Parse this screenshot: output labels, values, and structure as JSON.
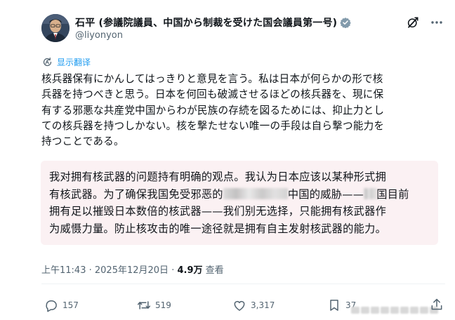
{
  "author": {
    "display_name": "石平 (参議院議員、中国から制裁を受けた国会議員第一号)",
    "handle": "@liyonyon",
    "verified": true
  },
  "translate_label": "显示翻译",
  "body_lines": [
    "核兵器保有にかんしてはっきりと意見を言う。私は日本が何らかの形で核",
    "兵器を持つべきと思う。日本を何回も破滅させるほどの核兵器を、現に保",
    "有する邪悪な共産党中国からわが民族の存続を図るためには、抑止力とし",
    "ての核兵器を持つしかない。核を撃たせない唯一の手段は自ら撃つ能力を",
    "持つことである。"
  ],
  "translation": {
    "line1": "我对拥有核武器的问题持有明确的观点。我认为日本应该以某种形式拥",
    "line2": "有核武器。为了确保我国免受邪恶的",
    "line2b": "中国的威胁——",
    "line2c": "国目前",
    "line3": "拥有足以摧毁日本数倍的核武器——我们别无选择，只能拥有核武器作",
    "line4": "为威慑力量。防止核攻击的唯一途径就是拥有自主发射核武器的能力。"
  },
  "meta": {
    "time": "上午11:43",
    "separator": "·",
    "date": "2025年12月20日",
    "views_count": "4.9万",
    "views_label": "查看"
  },
  "actions": {
    "replies": "157",
    "retweets": "519",
    "likes": "3,317",
    "bookmarks": "37"
  },
  "icons": [
    "verified-badge-icon",
    "grok-icon",
    "more-icon",
    "translate-icon",
    "reply-icon",
    "retweet-icon",
    "like-icon",
    "bookmark-icon",
    "share-icon"
  ],
  "colors": {
    "accent": "#1d9bf0",
    "text": "#0f1419",
    "secondary": "#536471",
    "translation_bg": "#fbf1f3"
  }
}
